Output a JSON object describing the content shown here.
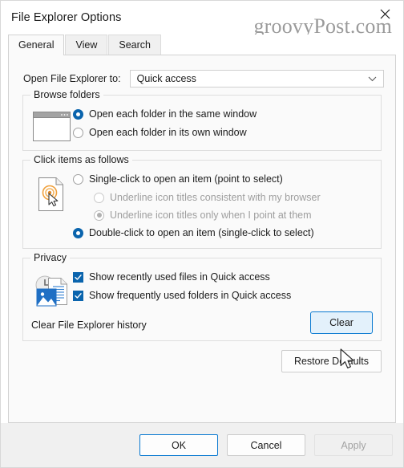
{
  "window": {
    "title": "File Explorer Options",
    "close_icon": "close-x-icon",
    "watermark": "groovyPost.com"
  },
  "tabs": [
    {
      "label": "General",
      "active": true
    },
    {
      "label": "View",
      "active": false
    },
    {
      "label": "Search",
      "active": false
    }
  ],
  "general": {
    "open_to": {
      "label": "Open File Explorer to:",
      "value": "Quick access",
      "chevron_icon": "chevron-down-icon"
    },
    "browse_folders": {
      "legend": "Browse folders",
      "icon": "window-preview-icon",
      "options": [
        {
          "label": "Open each folder in the same window",
          "checked": true
        },
        {
          "label": "Open each folder in its own window",
          "checked": false
        }
      ]
    },
    "click_items": {
      "legend": "Click items as follows",
      "icon": "document-click-cursor-icon",
      "options": [
        {
          "label": "Single-click to open an item (point to select)",
          "checked": false,
          "disabled": false,
          "indent": false
        },
        {
          "label": "Underline icon titles consistent with my browser",
          "checked": false,
          "disabled": true,
          "indent": true
        },
        {
          "label": "Underline icon titles only when I point at them",
          "checked": true,
          "disabled": true,
          "indent": true
        },
        {
          "label": "Double-click to open an item (single-click to select)",
          "checked": true,
          "disabled": false,
          "indent": false
        }
      ]
    },
    "privacy": {
      "legend": "Privacy",
      "icon": "recent-files-photo-icon",
      "checkboxes": [
        {
          "label": "Show recently used files in Quick access",
          "checked": true
        },
        {
          "label": "Show frequently used folders in Quick access",
          "checked": true
        }
      ],
      "clear_history_label": "Clear File Explorer history",
      "clear_button": "Clear"
    },
    "restore_defaults": "Restore Defaults"
  },
  "footer": {
    "ok": "OK",
    "cancel": "Cancel",
    "apply": "Apply"
  },
  "colors": {
    "accent": "#0a64ad",
    "focus_border": "#0a7ad1",
    "hover_fill": "#e3f1fb",
    "disabled_text": "#9e9e9e"
  },
  "cursor": {
    "icon": "mouse-pointer-arrow"
  }
}
